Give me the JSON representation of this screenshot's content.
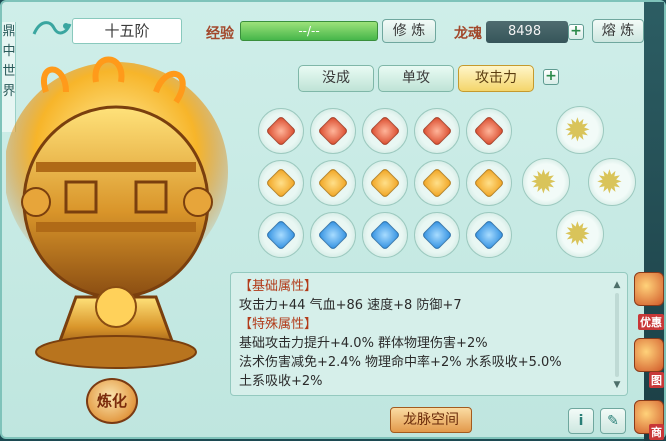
{
  "left_strip": [
    "鼎",
    "中",
    "世",
    "界"
  ],
  "header": {
    "rank": "十五阶",
    "exp_label": "经验",
    "exp_value": "--/--",
    "cultivate_button": "修 炼",
    "soul_label": "龙魂",
    "soul_value": "8498",
    "plus_symbol": "+",
    "smelt_button": "熔 炼"
  },
  "tabs": [
    {
      "label": "没成",
      "active": false
    },
    {
      "label": "单攻",
      "active": false
    },
    {
      "label": "攻击力",
      "active": true
    }
  ],
  "tab_add": "+",
  "gems": {
    "rows": [
      {
        "color": "#d9482a",
        "count": 5
      },
      {
        "color": "#f0a21f",
        "count": 5
      },
      {
        "color": "#2e8ee0",
        "count": 5
      }
    ],
    "dragon_orbs": 4
  },
  "attributes": {
    "base_title": "【基础属性】",
    "base_line": "攻击力+44  气血+86  速度+8  防御+7",
    "special_title": "【特殊属性】",
    "special_lines": [
      "基础攻击力提升+4.0%  群体物理伤害+2%",
      "法术伤害减免+2.4%  物理命中率+2%  水系吸收+5.0%",
      "土系吸收+2%"
    ]
  },
  "refine_button": "炼化",
  "space_button": "龙脉空间",
  "info_icon": "i",
  "edit_icon": "✎",
  "right_edge": {
    "promo_1": "优惠",
    "promo_2": "图",
    "promo_3": "商"
  }
}
